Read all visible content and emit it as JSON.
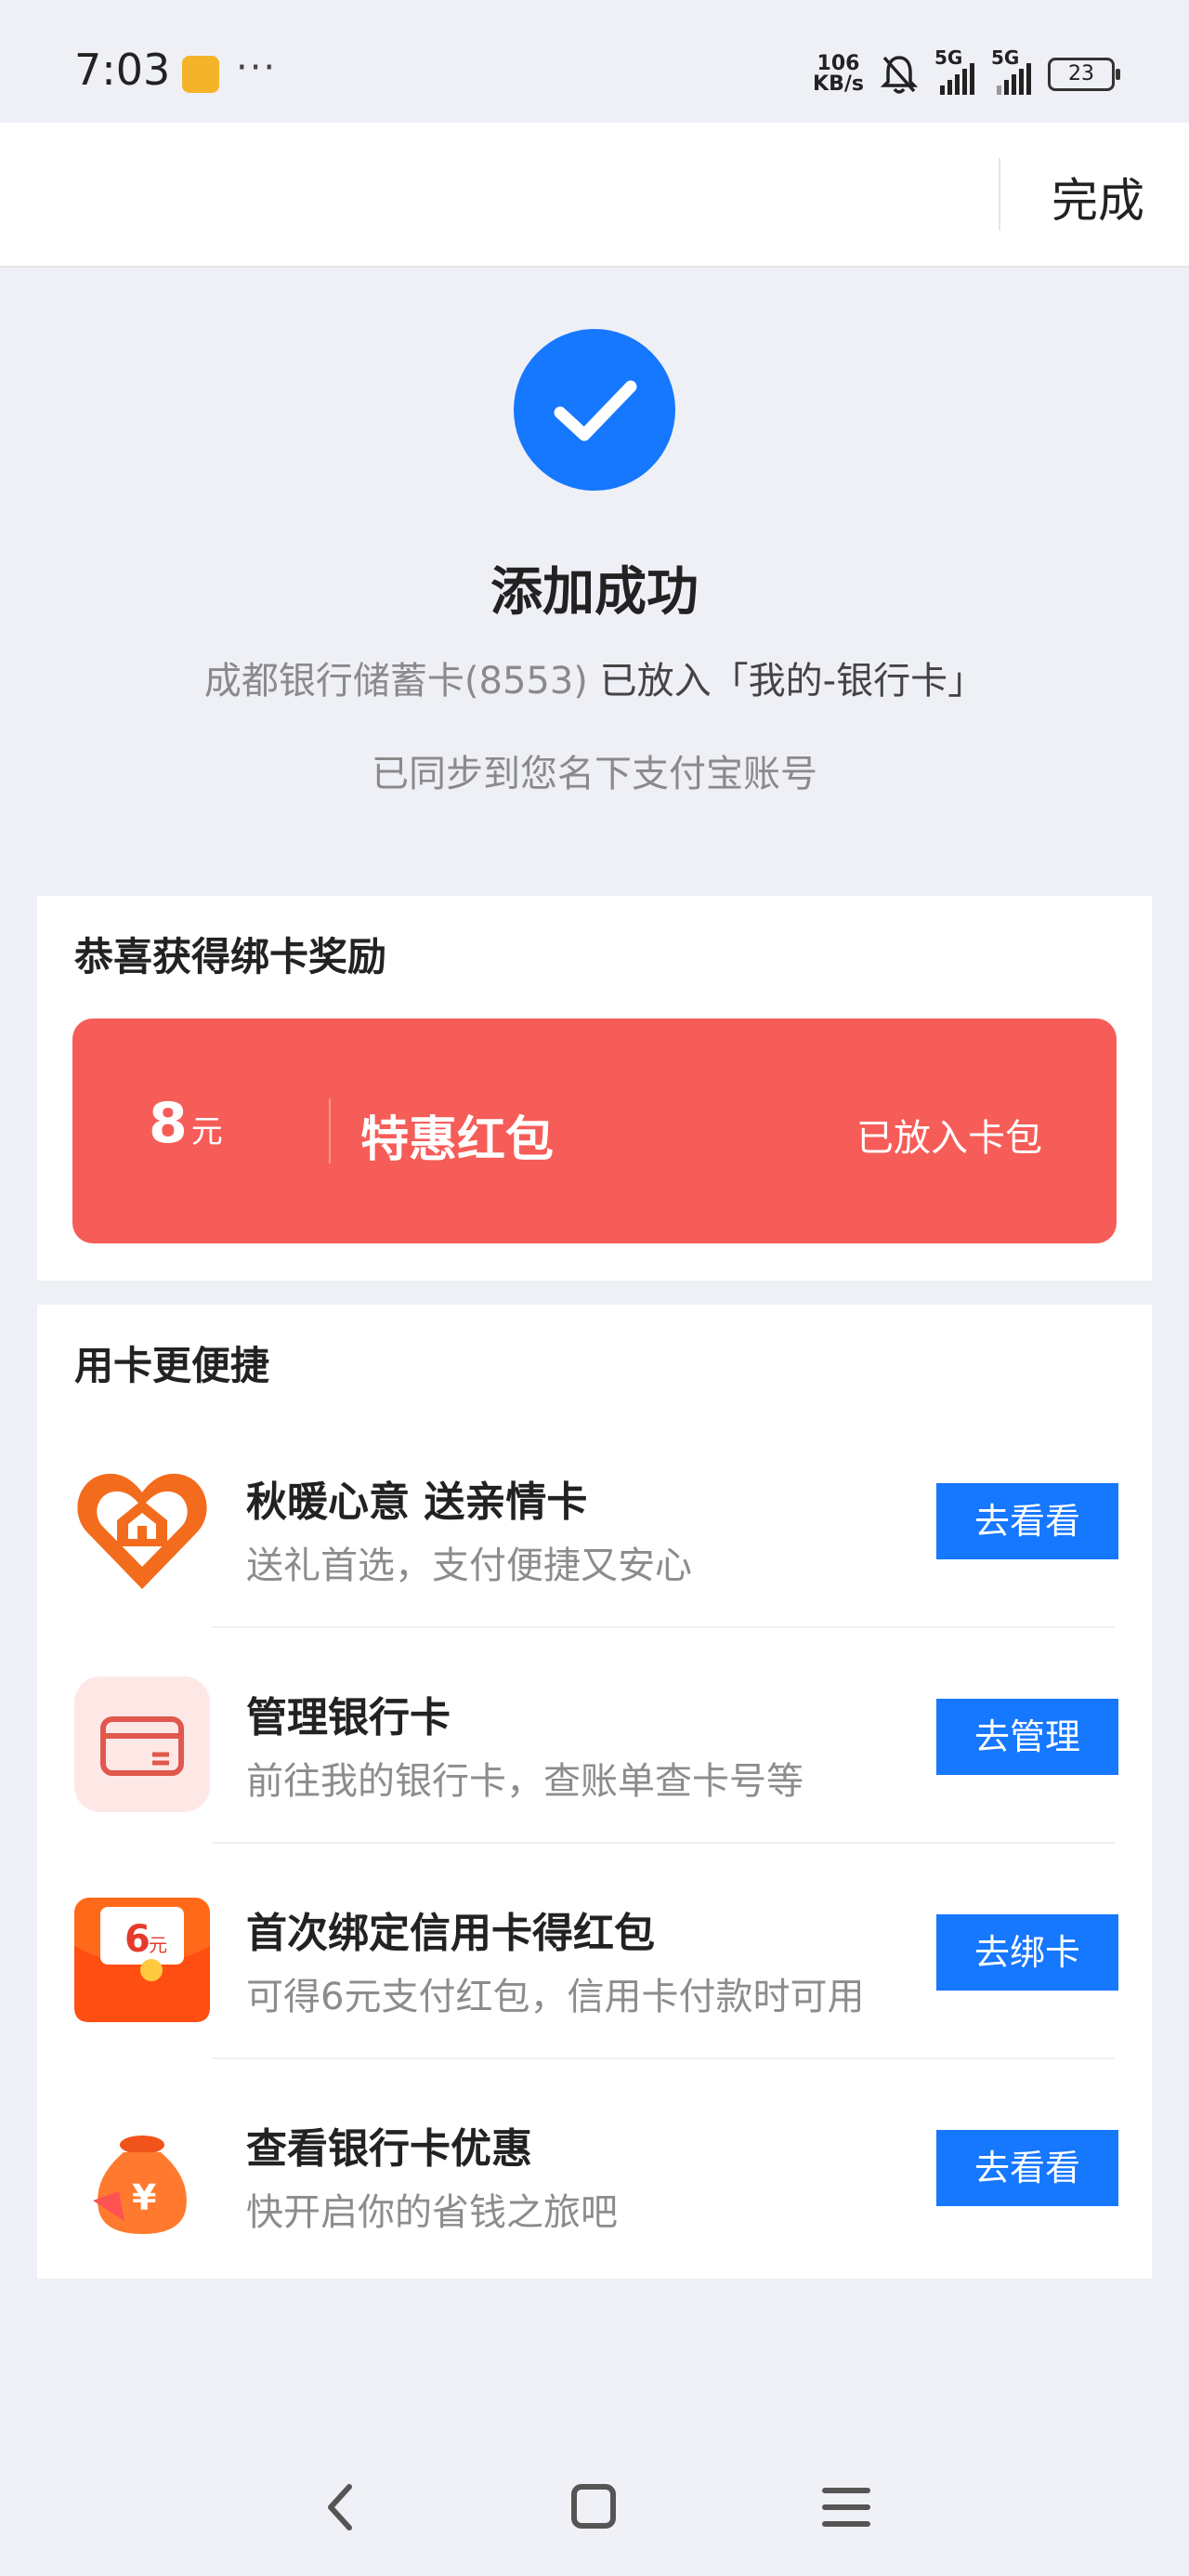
{
  "status_bar": {
    "time": "7:03",
    "speed_top": "106",
    "speed_bottom": "KB/s",
    "net1": "5G",
    "net2": "5G",
    "battery": "23",
    "icons": [
      "note-icon",
      "more-dots-icon",
      "bell-off-icon",
      "signal-icon",
      "battery-icon"
    ]
  },
  "header": {
    "done_label": "完成"
  },
  "success": {
    "title": "添加成功",
    "card_name": "成都银行储蓄卡(8553)",
    "placed_text": "已放入「我的-银行卡」",
    "sync_text": "已同步到您名下支付宝账号",
    "accent_color": "#1677ff"
  },
  "reward": {
    "title": "恭喜获得绑卡奖励",
    "amount": "8",
    "unit": "元",
    "name": "特惠红包",
    "status": "已放入卡包",
    "color": "#f65d58"
  },
  "convenience": {
    "title": "用卡更便捷",
    "items": [
      {
        "title": "秋暖心意 送亲情卡",
        "subtitle": "送礼首选，支付便捷又安心",
        "button": "去看看",
        "icon": "heart-house-icon"
      },
      {
        "title": "管理银行卡",
        "subtitle": "前往我的银行卡，查账单查卡号等",
        "button": "去管理",
        "icon": "bank-card-icon"
      },
      {
        "title": "首次绑定信用卡得红包",
        "subtitle": "可得6元支付红包，信用卡付款时可用",
        "button": "去绑卡",
        "icon": "red-envelope-icon",
        "icon_amount": "6",
        "icon_unit": "元"
      },
      {
        "title": "查看银行卡优惠",
        "subtitle": "快开启你的省钱之旅吧",
        "button": "去看看",
        "icon": "money-bag-icon",
        "icon_symbol": "¥"
      }
    ]
  }
}
